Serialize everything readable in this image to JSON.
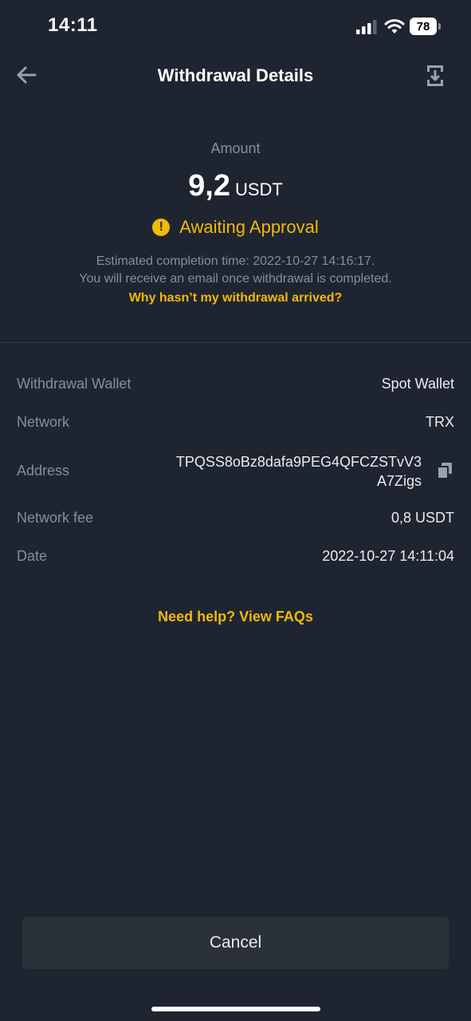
{
  "status_bar": {
    "time": "14:11",
    "battery": "78"
  },
  "header": {
    "title": "Withdrawal Details",
    "back_icon": "arrow-left-icon",
    "share_icon": "download-share-icon"
  },
  "amount": {
    "label": "Amount",
    "value": "9,2",
    "unit": "USDT"
  },
  "status": {
    "icon": "warning-icon",
    "icon_glyph": "!",
    "text": "Awaiting Approval",
    "eta": "Estimated completion time: 2022-10-27 14:16:17.",
    "email_notice": "You will receive an email once withdrawal is completed.",
    "why_link": "Why hasn’t my withdrawal arrived?"
  },
  "details": {
    "wallet": {
      "label": "Withdrawal Wallet",
      "value": "Spot Wallet"
    },
    "network": {
      "label": "Network",
      "value": "TRX"
    },
    "address": {
      "label": "Address",
      "value": "TPQSS8oBz8dafa9PEG4QFCZSTvV3A7Zigs"
    },
    "fee": {
      "label": "Network fee",
      "value": "0,8 USDT"
    },
    "date": {
      "label": "Date",
      "value": "2022-10-27 14:11:04"
    }
  },
  "faq_link": "Need help? View FAQs",
  "cancel_label": "Cancel",
  "colors": {
    "background": "#1f2530",
    "accent": "#f0b90b",
    "muted": "#848e9c",
    "button": "#2b3139"
  }
}
